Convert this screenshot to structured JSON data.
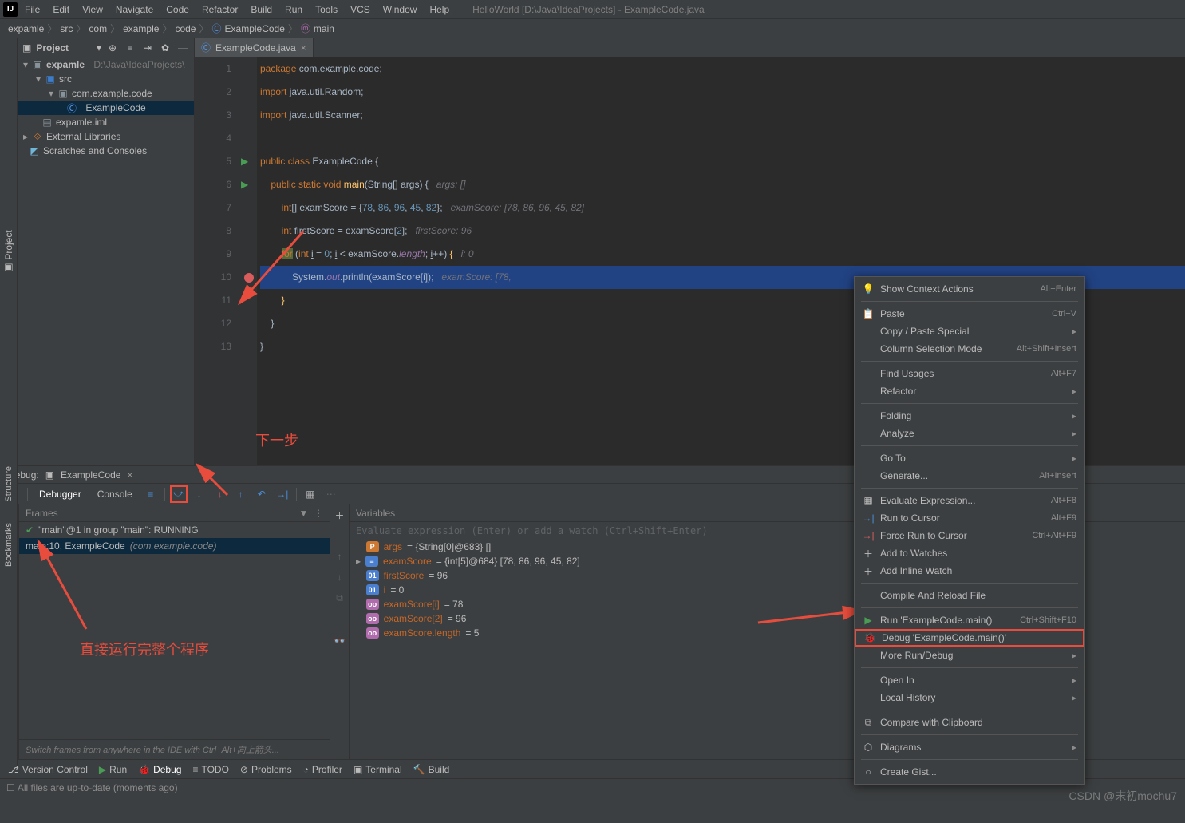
{
  "menubar": {
    "items": [
      "File",
      "Edit",
      "View",
      "Navigate",
      "Code",
      "Refactor",
      "Build",
      "Run",
      "Tools",
      "VCS",
      "Window",
      "Help"
    ],
    "title": "HelloWorld [D:\\Java\\IdeaProjects] - ExampleCode.java"
  },
  "breadcrumb": [
    "expamle",
    "src",
    "com",
    "example",
    "code",
    "ExampleCode",
    "main"
  ],
  "leftGutter": {
    "project": "Project"
  },
  "projectTool": {
    "title": "Project"
  },
  "tree": {
    "root": {
      "name": "expamle",
      "hint": "D:\\Java\\IdeaProjects\\"
    },
    "src": "src",
    "pkg": "com.example.code",
    "cls": "ExampleCode",
    "iml": "expamle.iml",
    "ext": "External Libraries",
    "scr": "Scratches and Consoles"
  },
  "editor": {
    "tab": "ExampleCode.java",
    "lines": {
      "l1": "package com.example.code;",
      "l2": "import java.util.Random;",
      "l3": "import java.util.Scanner;",
      "l5": "public class ExampleCode {",
      "l6a": "public static void ",
      "l6b": "main",
      "l6c": "(String[] args) {   ",
      "l6d": "args: []",
      "l7a": "int",
      "l7b": "[] examScore = {",
      "l7c": "78",
      "l7d": ", ",
      "l7e": "86",
      "l7f": "96",
      "l7g": "45",
      "l7h": "82",
      "l7i": "};   ",
      "l7j": "examScore: [78, 86, 96, 45, 82]",
      "l8a": "int ",
      "l8b": "firstScore = examScore[",
      "l8c": "2",
      "l8d": "];   ",
      "l8e": "firstScore: 96",
      "l9a": "for ",
      "l9b": "(",
      "l9c": "int ",
      "l9d": "i = ",
      "l9e": "0",
      "l9f": "; i < examScore.",
      "l9g": "length",
      "l9h": "; i++) ",
      "l9i": "{   ",
      "l9j": "i: 0",
      "l10a": "System.",
      "l10b": "out",
      "l10c": ".println(examScore[i]);   ",
      "l10d": "examScore: [78,",
      "l11": "}",
      "l12": "}",
      "l13": "}"
    },
    "annotations": {
      "nextStep": "下一步",
      "runWhole": "直接运行完整个程序"
    }
  },
  "debug": {
    "title": "Debug:",
    "config": "ExampleCode",
    "tabs": {
      "debugger": "Debugger",
      "console": "Console"
    },
    "frames": {
      "header": "Frames",
      "thread": "\"main\"@1 in group \"main\": RUNNING",
      "frame0a": "main:10, ExampleCode ",
      "frame0b": "(com.example.code)",
      "footer": "Switch frames from anywhere in the IDE with Ctrl+Alt+向上箭头..."
    },
    "vars": {
      "header": "Variables",
      "eval": "Evaluate expression (Enter) or add a watch (Ctrl+Shift+Enter)",
      "args_n": "args",
      "args_v": " = {String[0]@683} []",
      "exam_n": "examScore",
      "exam_v": " = {int[5]@684} [78, 86, 96, 45, 82]",
      "first_n": "firstScore",
      "first_v": " = 96",
      "i_n": "i",
      "i_v": " = 0",
      "w1_n": "examScore[i]",
      "w1_v": " = 78",
      "w2_n": "examScore[2]",
      "w2_v": " = 96",
      "w3_n": "examScore.length",
      "w3_v": " = 5"
    }
  },
  "contextMenu": {
    "showContext": "Show Context Actions",
    "showContextSc": "Alt+Enter",
    "paste": "Paste",
    "pasteSc": "Ctrl+V",
    "copyPaste": "Copy / Paste Special",
    "colSel": "Column Selection Mode",
    "colSelSc": "Alt+Shift+Insert",
    "findUsages": "Find Usages",
    "findUsagesSc": "Alt+F7",
    "refactor": "Refactor",
    "folding": "Folding",
    "analyze": "Analyze",
    "goto": "Go To",
    "generate": "Generate...",
    "generateSc": "Alt+Insert",
    "evalExpr": "Evaluate Expression...",
    "evalExprSc": "Alt+F8",
    "runCursor": "Run to Cursor",
    "runCursorSc": "Alt+F9",
    "forceRun": "Force Run to Cursor",
    "forceRunSc": "Ctrl+Alt+F9",
    "addWatch": "Add to Watches",
    "addInline": "Add Inline Watch",
    "compile": "Compile And Reload File",
    "runMain": "Run 'ExampleCode.main()'",
    "runMainSc": "Ctrl+Shift+F10",
    "debugMain": "Debug 'ExampleCode.main()'",
    "moreRun": "More Run/Debug",
    "openIn": "Open In",
    "localHist": "Local History",
    "compare": "Compare with Clipboard",
    "diagrams": "Diagrams",
    "gist": "Create Gist..."
  },
  "bottomBar": {
    "vcs": "Version Control",
    "run": "Run",
    "debug": "Debug",
    "todo": "TODO",
    "problems": "Problems",
    "profiler": "Profiler",
    "terminal": "Terminal",
    "build": "Build"
  },
  "statusBar": {
    "msg": "All files are up-to-date (moments ago)"
  },
  "rightStrip": {
    "structure": "Structure",
    "bookmarks": "Bookmarks"
  },
  "watermark": "CSDN @末初mochu7"
}
